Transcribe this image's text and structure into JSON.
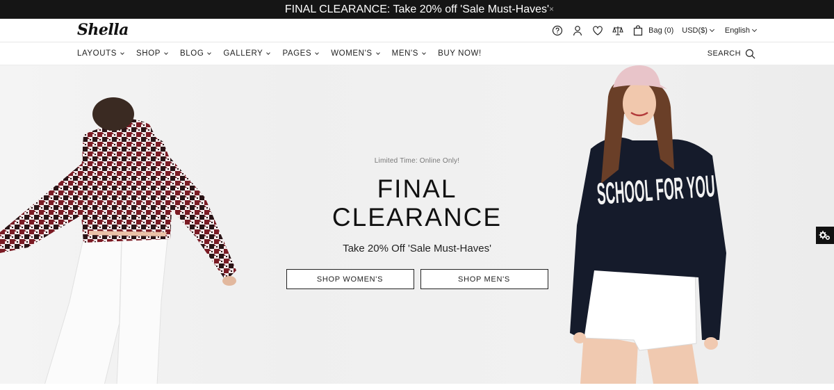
{
  "announcement": {
    "text": "FINAL CLEARANCE: Take 20% off 'Sale Must-Haves'",
    "close": "×"
  },
  "header": {
    "logo": "Shella",
    "bag_label": "Bag (0)",
    "currency": "USD($)",
    "language": "English",
    "icons": [
      "help-icon",
      "account-icon",
      "wishlist-icon",
      "compare-icon",
      "bag-icon"
    ]
  },
  "nav": {
    "items": [
      {
        "label": "LAYOUTS",
        "has_dropdown": true
      },
      {
        "label": "SHOP",
        "has_dropdown": true
      },
      {
        "label": "BLOG",
        "has_dropdown": true
      },
      {
        "label": "GALLERY",
        "has_dropdown": true
      },
      {
        "label": "PAGES",
        "has_dropdown": true
      },
      {
        "label": "WOMEN'S",
        "has_dropdown": true
      },
      {
        "label": "MEN'S",
        "has_dropdown": true
      },
      {
        "label": "BUY NOW!",
        "has_dropdown": false
      }
    ],
    "search_label": "SEARCH"
  },
  "hero": {
    "eyebrow": "Limited Time: Online Only!",
    "headline_line1": "FINAL",
    "headline_line2": "CLEARANCE",
    "subline": "Take 20% Off 'Sale Must-Haves'",
    "cta_women": "SHOP WOMEN'S",
    "cta_men": "SHOP MEN'S",
    "sweater_print": "SCHOOL FOR YOU"
  },
  "colors": {
    "topbar_bg": "#151515",
    "hero_bg": "#f2f2f2",
    "text": "#111111"
  }
}
